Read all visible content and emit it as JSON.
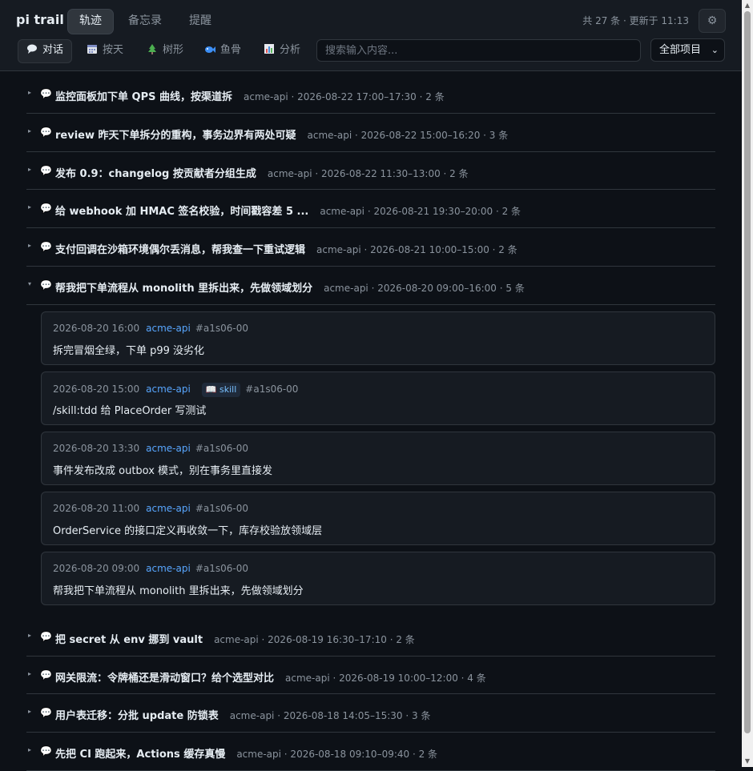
{
  "app": {
    "brand": "pi trail",
    "status": "共 27 条 · 更新于 11:13",
    "settings_icon": "⚙"
  },
  "nav": {
    "tabs": [
      {
        "label": "轨迹"
      },
      {
        "label": "备忘录"
      },
      {
        "label": "提醒"
      }
    ]
  },
  "views": [
    {
      "label": "对话",
      "icon": "speech-bubble-icon"
    },
    {
      "label": "按天",
      "icon": "calendar-icon"
    },
    {
      "label": "树形",
      "icon": "tree-icon"
    },
    {
      "label": "鱼骨",
      "icon": "fish-icon"
    },
    {
      "label": "分析",
      "icon": "bar-chart-icon"
    }
  ],
  "search": {
    "placeholder": "搜索输入内容..."
  },
  "project_filter": {
    "value": "全部项目"
  },
  "sessions": [
    {
      "title": "监控面板加下单 QPS 曲线，按渠道拆",
      "meta": "acme-api · 2026-08-22 17:00–17:30 · 2 条"
    },
    {
      "title": "review 昨天下单拆分的重构，事务边界有两处可疑",
      "meta": "acme-api · 2026-08-22 15:00–16:20 · 3 条"
    },
    {
      "title": "发布 0.9：changelog 按贡献者分组生成",
      "meta": "acme-api · 2026-08-22 11:30–13:00 · 2 条"
    },
    {
      "title": "给 webhook 加 HMAC 签名校验，时间戳容差 5 ...",
      "meta": "acme-api · 2026-08-21 19:30–20:00 · 2 条"
    },
    {
      "title": "支付回调在沙箱环境偶尔丢消息，帮我查一下重试逻辑",
      "meta": "acme-api · 2026-08-21 10:00–15:00 · 2 条"
    },
    {
      "title": "帮我把下单流程从 monolith 里拆出来，先做领域划分",
      "meta": "acme-api · 2026-08-20 09:00–16:00 · 5 条"
    },
    {
      "title": "把 secret 从 env 挪到 vault",
      "meta": "acme-api · 2026-08-19 16:30–17:10 · 2 条"
    },
    {
      "title": "网关限流：令牌桶还是滑动窗口？给个选型对比",
      "meta": "acme-api · 2026-08-19 10:00–12:00 · 4 条"
    },
    {
      "title": "用户表迁移：分批 update 防锁表",
      "meta": "acme-api · 2026-08-18 14:05–15:30 · 3 条"
    },
    {
      "title": "先把 CI 跑起来，Actions 缓存真慢",
      "meta": "acme-api · 2026-08-18 09:10–09:40 · 2 条"
    }
  ],
  "expanded": {
    "messages": [
      {
        "time": "2026-08-20 16:00",
        "project": "acme-api",
        "tag": "",
        "id": "#a1s06-00",
        "text": "拆完冒烟全绿，下单 p99 没劣化"
      },
      {
        "time": "2026-08-20 15:00",
        "project": "acme-api",
        "tag": "📖 skill",
        "id": "#a1s06-00",
        "text": "/skill:tdd 给 PlaceOrder 写测试"
      },
      {
        "time": "2026-08-20 13:30",
        "project": "acme-api",
        "tag": "",
        "id": "#a1s06-00",
        "text": "事件发布改成 outbox 模式，别在事务里直接发"
      },
      {
        "time": "2026-08-20 11:00",
        "project": "acme-api",
        "tag": "",
        "id": "#a1s06-00",
        "text": "OrderService 的接口定义再收敛一下，库存校验放领域层"
      },
      {
        "time": "2026-08-20 09:00",
        "project": "acme-api",
        "tag": "",
        "id": "#a1s06-00",
        "text": "帮我把下单流程从 monolith 里拆出来，先做领域划分"
      }
    ]
  },
  "colors": {
    "bg": "#0d1117",
    "panel": "#161b22",
    "border": "#30363d",
    "accent": "#58a6ff"
  }
}
